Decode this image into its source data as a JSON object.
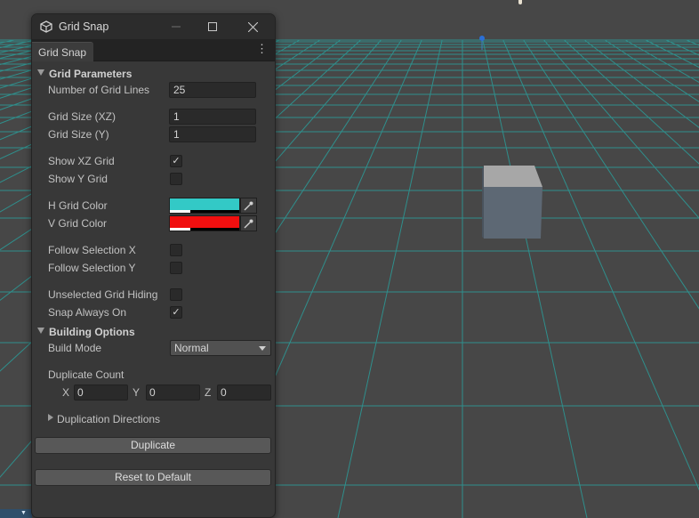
{
  "window": {
    "title": "Grid Snap",
    "tab_label": "Grid Snap"
  },
  "grid_parameters": {
    "header": "Grid Parameters",
    "number_of_grid_lines": {
      "label": "Number of Grid Lines",
      "value": "25"
    },
    "grid_size_xz": {
      "label": "Grid Size (XZ)",
      "value": "1"
    },
    "grid_size_y": {
      "label": "Grid Size (Y)",
      "value": "1"
    },
    "show_xz_grid": {
      "label": "Show XZ Grid",
      "checked": true
    },
    "show_y_grid": {
      "label": "Show Y Grid",
      "checked": false
    },
    "h_grid_color": {
      "label": "H Grid Color",
      "color": "#33c9c6"
    },
    "v_grid_color": {
      "label": "V Grid Color",
      "color": "#f10f0f"
    },
    "follow_selection_x": {
      "label": "Follow Selection X",
      "checked": false
    },
    "follow_selection_y": {
      "label": "Follow Selection Y",
      "checked": false
    },
    "unselected_grid_hiding": {
      "label": "Unselected Grid Hiding",
      "checked": false
    },
    "snap_always_on": {
      "label": "Snap Always On",
      "checked": true
    }
  },
  "building_options": {
    "header": "Building Options",
    "build_mode": {
      "label": "Build Mode",
      "value": "Normal"
    },
    "duplicate_count": {
      "label": "Duplicate Count",
      "x_label": "X",
      "x_value": "0",
      "y_label": "Y",
      "y_value": "0",
      "z_label": "Z",
      "z_value": "0"
    },
    "duplication_directions": {
      "label": "Duplication Directions"
    }
  },
  "buttons": {
    "duplicate": "Duplicate",
    "reset": "Reset to Default"
  },
  "icons": {
    "app": "unity-cube-icon",
    "eyedropper": "eyedropper-icon",
    "minimize": "minimize-icon",
    "maximize": "maximize-icon",
    "close": "close-icon",
    "menu": "kebab-menu-icon"
  },
  "colors": {
    "scene_background": "#474747",
    "grid_line": "#2f8f8c",
    "panel_background": "#383838"
  }
}
